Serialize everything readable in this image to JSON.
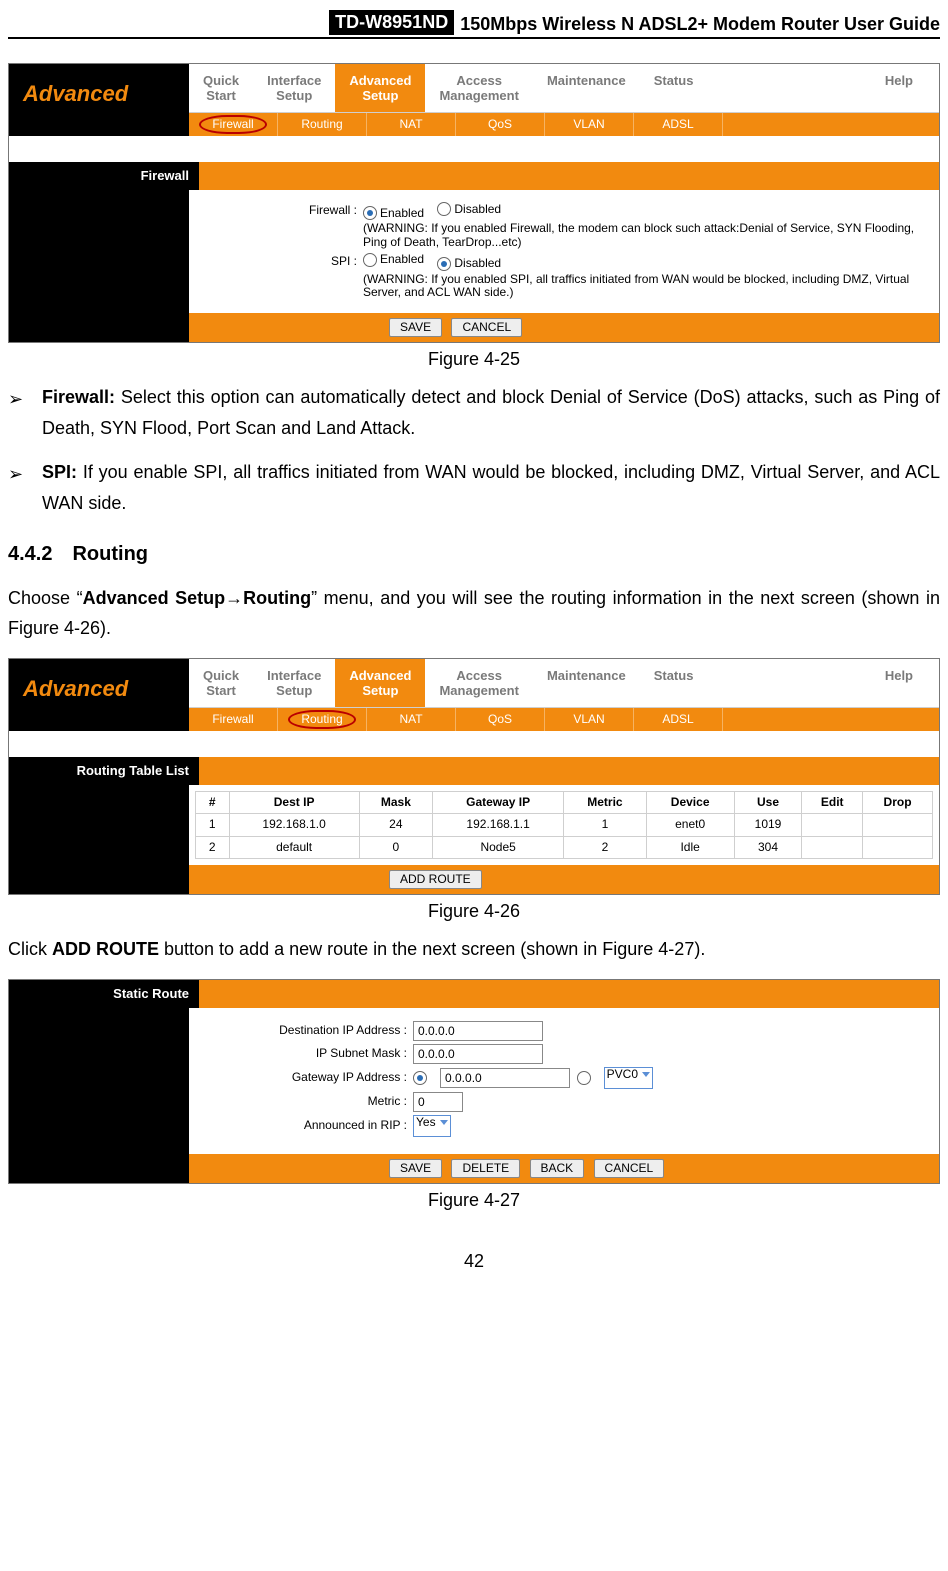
{
  "doc_header": {
    "model": "TD-W8951ND",
    "title": "150Mbps Wireless N ADSL2+ Modem Router User Guide"
  },
  "nav": {
    "brand": "Advanced",
    "top_tabs": [
      "Quick\nStart",
      "Interface\nSetup",
      "Advanced\nSetup",
      "Access\nManagement",
      "Maintenance",
      "Status",
      "Help"
    ],
    "sub_tabs": [
      "Firewall",
      "Routing",
      "NAT",
      "QoS",
      "VLAN",
      "ADSL"
    ]
  },
  "fig25": {
    "caption": "Figure 4-25",
    "section_label": "Firewall",
    "rows": {
      "firewall": {
        "label": "Firewall :",
        "opt_enabled": "Enabled",
        "opt_disabled": "Disabled",
        "selected": "enabled",
        "warn": "(WARNING: If you enabled Firewall, the modem can block such attack:Denial of Service, SYN Flooding, Ping of Death, TearDrop...etc)"
      },
      "spi": {
        "label": "SPI :",
        "opt_enabled": "Enabled",
        "opt_disabled": "Disabled",
        "selected": "disabled",
        "warn": "(WARNING: If you enabled SPI, all traffics initiated from WAN would be blocked, including DMZ, Virtual Server, and ACL WAN side.)"
      }
    },
    "buttons": {
      "save": "SAVE",
      "cancel": "CANCEL"
    }
  },
  "text": {
    "bullet_firewall_label": "Firewall:",
    "bullet_firewall": " Select this option can automatically detect and block Denial of Service (DoS) attacks, such as Ping of Death, SYN Flood, Port Scan and Land Attack.",
    "bullet_spi_label": "SPI:",
    "bullet_spi": " If you enable SPI, all traffics initiated from WAN would be blocked, including DMZ, Virtual Server, and ACL WAN side.",
    "h442": "4.4.2 Routing",
    "routing_intro_pre": "Choose “",
    "routing_intro_bold": "Advanced Setup→Routing",
    "routing_intro_post": "” menu, and you will see the routing information in the next screen (shown in Figure 4-26).",
    "click_addroute_pre": "Click ",
    "click_addroute_bold": "ADD ROUTE",
    "click_addroute_post": " button to add a new route in the next screen (shown in Figure 4-27)."
  },
  "fig26": {
    "caption": "Figure 4-26",
    "section_label": "Routing Table List",
    "headers": [
      "#",
      "Dest IP",
      "Mask",
      "Gateway IP",
      "Metric",
      "Device",
      "Use",
      "Edit",
      "Drop"
    ],
    "rows": [
      [
        "1",
        "192.168.1.0",
        "24",
        "192.168.1.1",
        "1",
        "enet0",
        "1019",
        "",
        ""
      ],
      [
        "2",
        "default",
        "0",
        "Node5",
        "2",
        "Idle",
        "304",
        "",
        ""
      ]
    ],
    "button": "ADD ROUTE"
  },
  "fig27": {
    "caption": "Figure 4-27",
    "section_label": "Static Route",
    "fields": {
      "dest_label": "Destination IP Address :",
      "dest": "0.0.0.0",
      "mask_label": "IP Subnet Mask :",
      "mask": "0.0.0.0",
      "gw_label": "Gateway IP Address :",
      "gw": "0.0.0.0",
      "gw_sel": "PVC0",
      "metric_label": "Metric :",
      "metric": "0",
      "rip_label": "Announced in RIP :",
      "rip": "Yes"
    },
    "buttons": {
      "save": "SAVE",
      "delete": "DELETE",
      "back": "BACK",
      "cancel": "CANCEL"
    }
  },
  "page_number": "42"
}
